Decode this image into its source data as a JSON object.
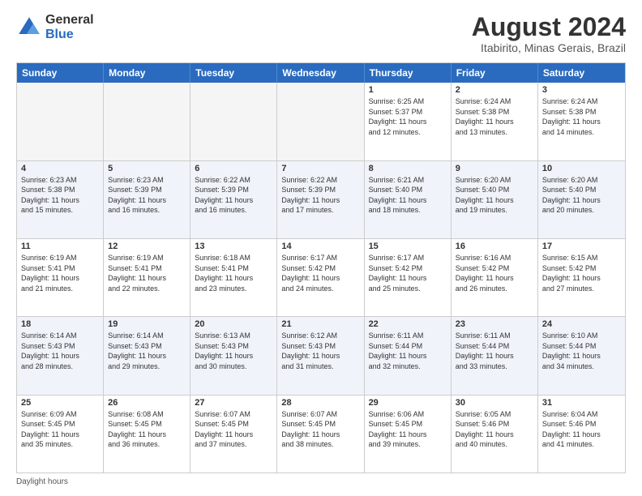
{
  "logo": {
    "general": "General",
    "blue": "Blue"
  },
  "title": "August 2024",
  "subtitle": "Itabirito, Minas Gerais, Brazil",
  "header_days": [
    "Sunday",
    "Monday",
    "Tuesday",
    "Wednesday",
    "Thursday",
    "Friday",
    "Saturday"
  ],
  "footer": "Daylight hours",
  "weeks": [
    [
      {
        "day": "",
        "info": ""
      },
      {
        "day": "",
        "info": ""
      },
      {
        "day": "",
        "info": ""
      },
      {
        "day": "",
        "info": ""
      },
      {
        "day": "1",
        "info": "Sunrise: 6:25 AM\nSunset: 5:37 PM\nDaylight: 11 hours\nand 12 minutes."
      },
      {
        "day": "2",
        "info": "Sunrise: 6:24 AM\nSunset: 5:38 PM\nDaylight: 11 hours\nand 13 minutes."
      },
      {
        "day": "3",
        "info": "Sunrise: 6:24 AM\nSunset: 5:38 PM\nDaylight: 11 hours\nand 14 minutes."
      }
    ],
    [
      {
        "day": "4",
        "info": "Sunrise: 6:23 AM\nSunset: 5:38 PM\nDaylight: 11 hours\nand 15 minutes."
      },
      {
        "day": "5",
        "info": "Sunrise: 6:23 AM\nSunset: 5:39 PM\nDaylight: 11 hours\nand 16 minutes."
      },
      {
        "day": "6",
        "info": "Sunrise: 6:22 AM\nSunset: 5:39 PM\nDaylight: 11 hours\nand 16 minutes."
      },
      {
        "day": "7",
        "info": "Sunrise: 6:22 AM\nSunset: 5:39 PM\nDaylight: 11 hours\nand 17 minutes."
      },
      {
        "day": "8",
        "info": "Sunrise: 6:21 AM\nSunset: 5:40 PM\nDaylight: 11 hours\nand 18 minutes."
      },
      {
        "day": "9",
        "info": "Sunrise: 6:20 AM\nSunset: 5:40 PM\nDaylight: 11 hours\nand 19 minutes."
      },
      {
        "day": "10",
        "info": "Sunrise: 6:20 AM\nSunset: 5:40 PM\nDaylight: 11 hours\nand 20 minutes."
      }
    ],
    [
      {
        "day": "11",
        "info": "Sunrise: 6:19 AM\nSunset: 5:41 PM\nDaylight: 11 hours\nand 21 minutes."
      },
      {
        "day": "12",
        "info": "Sunrise: 6:19 AM\nSunset: 5:41 PM\nDaylight: 11 hours\nand 22 minutes."
      },
      {
        "day": "13",
        "info": "Sunrise: 6:18 AM\nSunset: 5:41 PM\nDaylight: 11 hours\nand 23 minutes."
      },
      {
        "day": "14",
        "info": "Sunrise: 6:17 AM\nSunset: 5:42 PM\nDaylight: 11 hours\nand 24 minutes."
      },
      {
        "day": "15",
        "info": "Sunrise: 6:17 AM\nSunset: 5:42 PM\nDaylight: 11 hours\nand 25 minutes."
      },
      {
        "day": "16",
        "info": "Sunrise: 6:16 AM\nSunset: 5:42 PM\nDaylight: 11 hours\nand 26 minutes."
      },
      {
        "day": "17",
        "info": "Sunrise: 6:15 AM\nSunset: 5:42 PM\nDaylight: 11 hours\nand 27 minutes."
      }
    ],
    [
      {
        "day": "18",
        "info": "Sunrise: 6:14 AM\nSunset: 5:43 PM\nDaylight: 11 hours\nand 28 minutes."
      },
      {
        "day": "19",
        "info": "Sunrise: 6:14 AM\nSunset: 5:43 PM\nDaylight: 11 hours\nand 29 minutes."
      },
      {
        "day": "20",
        "info": "Sunrise: 6:13 AM\nSunset: 5:43 PM\nDaylight: 11 hours\nand 30 minutes."
      },
      {
        "day": "21",
        "info": "Sunrise: 6:12 AM\nSunset: 5:43 PM\nDaylight: 11 hours\nand 31 minutes."
      },
      {
        "day": "22",
        "info": "Sunrise: 6:11 AM\nSunset: 5:44 PM\nDaylight: 11 hours\nand 32 minutes."
      },
      {
        "day": "23",
        "info": "Sunrise: 6:11 AM\nSunset: 5:44 PM\nDaylight: 11 hours\nand 33 minutes."
      },
      {
        "day": "24",
        "info": "Sunrise: 6:10 AM\nSunset: 5:44 PM\nDaylight: 11 hours\nand 34 minutes."
      }
    ],
    [
      {
        "day": "25",
        "info": "Sunrise: 6:09 AM\nSunset: 5:45 PM\nDaylight: 11 hours\nand 35 minutes."
      },
      {
        "day": "26",
        "info": "Sunrise: 6:08 AM\nSunset: 5:45 PM\nDaylight: 11 hours\nand 36 minutes."
      },
      {
        "day": "27",
        "info": "Sunrise: 6:07 AM\nSunset: 5:45 PM\nDaylight: 11 hours\nand 37 minutes."
      },
      {
        "day": "28",
        "info": "Sunrise: 6:07 AM\nSunset: 5:45 PM\nDaylight: 11 hours\nand 38 minutes."
      },
      {
        "day": "29",
        "info": "Sunrise: 6:06 AM\nSunset: 5:45 PM\nDaylight: 11 hours\nand 39 minutes."
      },
      {
        "day": "30",
        "info": "Sunrise: 6:05 AM\nSunset: 5:46 PM\nDaylight: 11 hours\nand 40 minutes."
      },
      {
        "day": "31",
        "info": "Sunrise: 6:04 AM\nSunset: 5:46 PM\nDaylight: 11 hours\nand 41 minutes."
      }
    ]
  ]
}
